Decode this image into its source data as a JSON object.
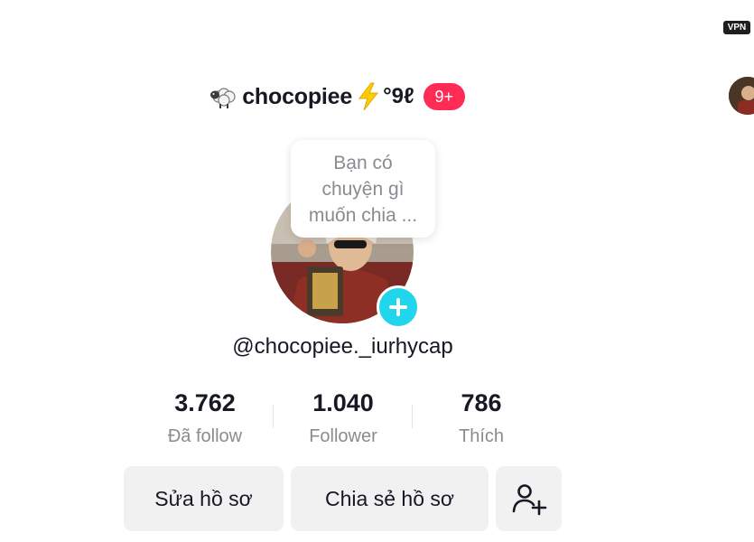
{
  "status": {
    "vpn_label": "VPN"
  },
  "profile": {
    "display_name": "chocopiee",
    "name_suffix": "°9ℓ",
    "notification_badge": "9+",
    "note_bubble": [
      "Bạn có",
      "chuyện gì",
      "muốn chia ..."
    ],
    "handle": "@chocopiee._iurhycap"
  },
  "stats": [
    {
      "value": "3.762",
      "label": "Đã follow"
    },
    {
      "value": "1.040",
      "label": "Follower"
    },
    {
      "value": "786",
      "label": "Thích"
    }
  ],
  "actions": {
    "edit_profile": "Sửa hồ sơ",
    "share_profile": "Chia sẻ hồ sơ"
  },
  "colors": {
    "accent_red": "#fe2c55",
    "add_button": "#20d5ec",
    "button_bg": "#f1f1f2",
    "secondary_text": "#8a8b91"
  },
  "icons": {
    "name_prefix": "sheep-icon",
    "name_emoji": "lightning-icon",
    "add_story": "plus-icon",
    "add_friend": "add-user-icon"
  }
}
